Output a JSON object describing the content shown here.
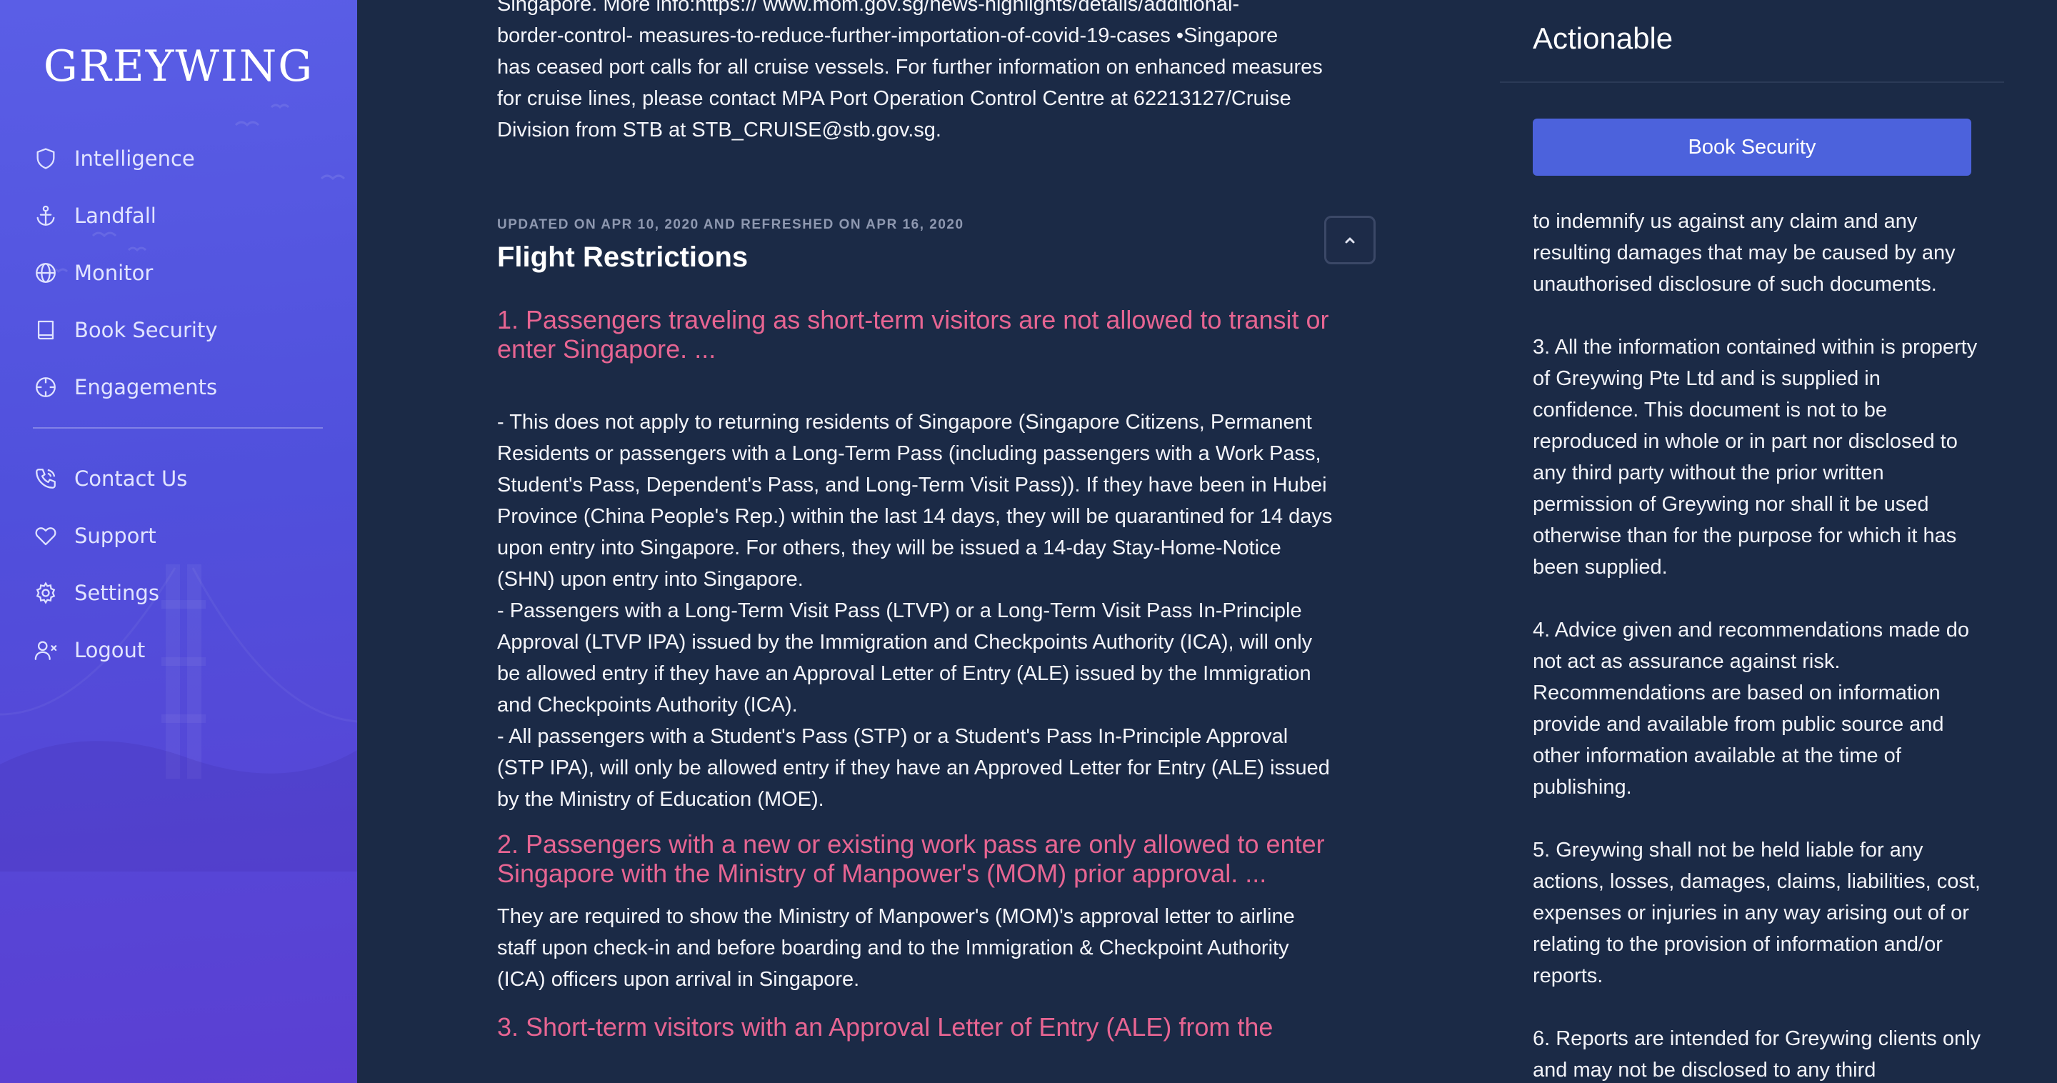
{
  "sidebar": {
    "logo": "GREYWING",
    "items": [
      {
        "label": "Intelligence",
        "icon": "shield-icon"
      },
      {
        "label": "Landfall",
        "icon": "anchor-icon"
      },
      {
        "label": "Monitor",
        "icon": "globe-icon"
      },
      {
        "label": "Book Security",
        "icon": "book-icon"
      },
      {
        "label": "Engagements",
        "icon": "crosshair-icon"
      }
    ],
    "secondary_items": [
      {
        "label": "Contact Us",
        "icon": "phone-icon"
      },
      {
        "label": "Support",
        "icon": "heart-icon"
      },
      {
        "label": "Settings",
        "icon": "gear-icon"
      },
      {
        "label": "Logout",
        "icon": "user-x-icon"
      }
    ]
  },
  "main": {
    "intro_text": "Singapore. More info:https:// www.mom.gov.sg/news-highlights/details/additional-\nborder-control- measures-to-reduce-further-importation-of-covid-19-cases •Singapore\nhas ceased port calls for all cruise vessels. For further information on enhanced measures\nfor cruise lines, please contact MPA Port Operation Control Centre at 62213127/Cruise\nDivision from STB at STB_CRUISE@stb.gov.sg.",
    "updated_label": "UPDATED ON APR 10, 2020 AND REFRESHED ON APR 16, 2020",
    "section_title": "Flight Restrictions",
    "restrictions": [
      {
        "heading": "1. Passengers traveling as short-term visitors are not allowed to transit or\nenter Singapore. ...",
        "body": "- This does not apply to returning residents of Singapore (Singapore Citizens, Permanent\nResidents or passengers with a Long-Term Pass (including passengers with a Work Pass,\nStudent's Pass, Dependent's Pass, and Long-Term Visit Pass)). If they have been in Hubei\nProvince (China People's Rep.) within the last 14 days, they will be quarantined for 14 days\nupon entry into Singapore. For others, they will be issued a 14-day Stay-Home-Notice\n(SHN) upon entry into Singapore.\n- Passengers with a Long-Term Visit Pass (LTVP) or a Long-Term Visit Pass In-Principle\nApproval (LTVP IPA) issued by the Immigration and Checkpoints Authority (ICA), will only\nbe allowed entry if they have an Approval Letter of Entry (ALE) issued by the Immigration\nand Checkpoints Authority (ICA).\n- All passengers with a Student's Pass (STP) or a Student's Pass In-Principle Approval\n(STP IPA), will only be allowed entry if they have an Approved Letter for Entry (ALE) issued\nby the Ministry of Education (MOE)."
      },
      {
        "heading": "2. Passengers with a new or existing work pass are only allowed to enter\nSingapore with the Ministry of Manpower's (MOM) prior approval. ...",
        "body": "They are required to show the Ministry of Manpower's (MOM)'s approval letter to airline\nstaff upon check-in and before boarding and to the Immigration & Checkpoint Authority\n(ICA) officers upon arrival in Singapore."
      },
      {
        "heading": "3. Short-term visitors with an Approval Letter of Entry (ALE) from the",
        "body": ""
      }
    ],
    "collapse_icon": "chevron-up-icon"
  },
  "actionable": {
    "title": "Actionable",
    "book_button": "Book Security",
    "terms": [
      "to indemnify us against any claim and any resulting damages that may be caused by any unauthorised disclosure of such documents.",
      "3. All the information contained within is property of Greywing Pte Ltd and is supplied in confidence. This document is not to be reproduced in whole or in part nor disclosed to any third party without the prior written permission of Greywing nor shall it be used otherwise than for the purpose for which it has been supplied.",
      "4. Advice given and recommendations made do not act as assurance against risk. Recommendations are based on information provide and available from public source and other information available at the time of publishing.",
      "5. Greywing shall not be held liable for any actions, losses, damages, claims, liabilities, cost, expenses or injuries in any way arising out of or relating to the provision of information and/or reports.",
      "6. Reports are intended for Greywing clients only and may not be disclosed to any third"
    ]
  }
}
